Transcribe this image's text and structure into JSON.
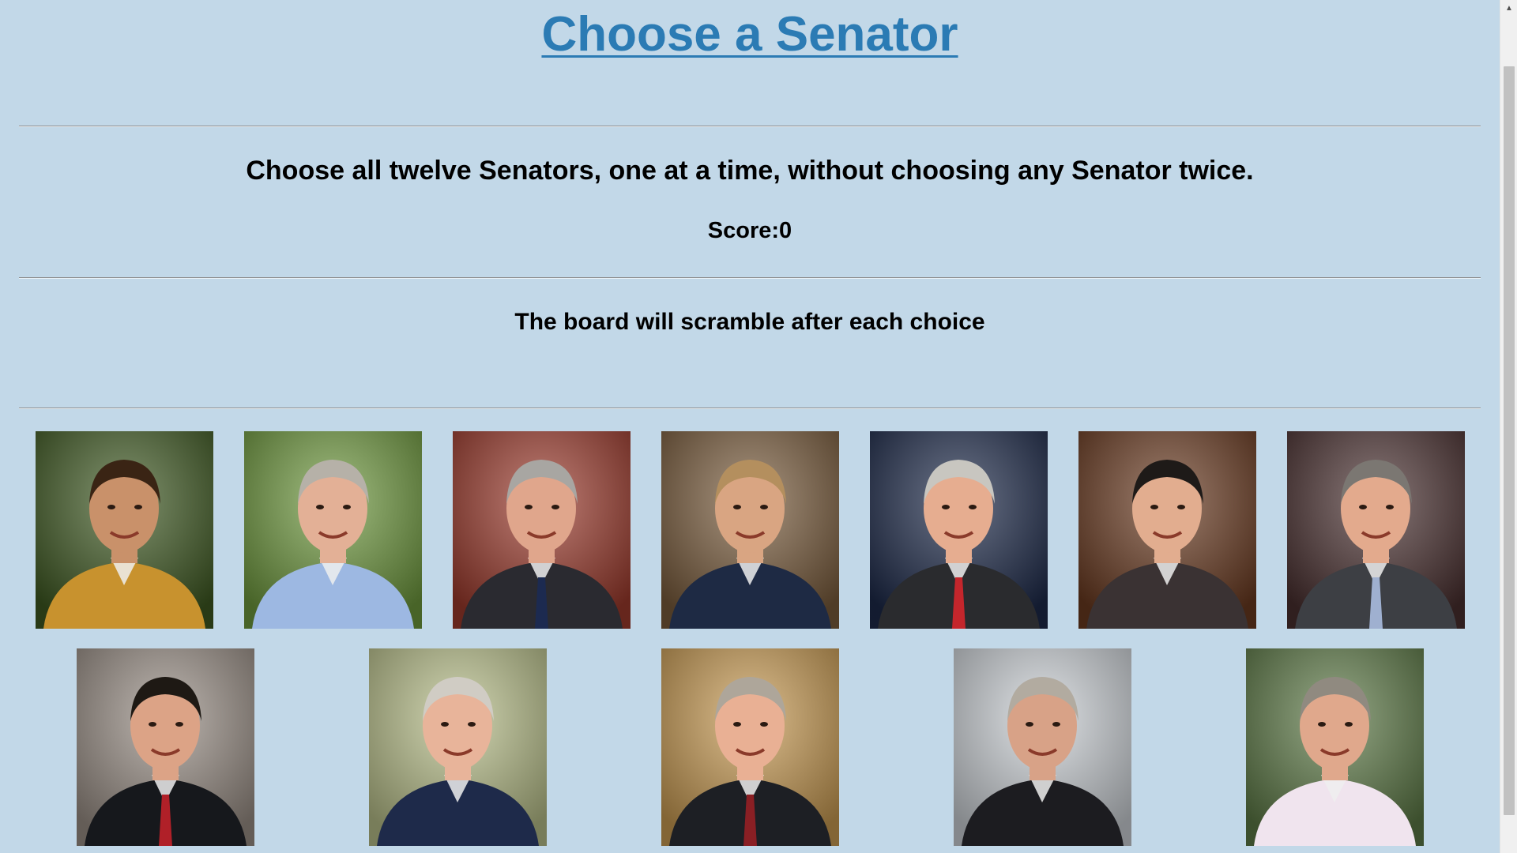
{
  "header": {
    "title": "Choose a Senator"
  },
  "game": {
    "instructions": "Choose all twelve Senators, one at a time, without choosing any Senator twice.",
    "score_text": "Score:0",
    "scramble_note": "The board will scramble after each choice"
  },
  "board": {
    "photos": [
      {
        "id": "senator-photo-1",
        "bg": "#3f5a22",
        "shirt": "#c8922e",
        "hair": "#3a2414",
        "skin": "#c9916a",
        "tie": null
      },
      {
        "id": "senator-photo-2",
        "bg": "#6f9a3e",
        "shirt": "#9db8e2",
        "hair": "#b6b1a8",
        "skin": "#e3b096",
        "tie": null
      },
      {
        "id": "senator-photo-3",
        "bg": "#9d3a2c",
        "shirt": "#2a2a30",
        "hair": "#a8a6a2",
        "skin": "#e0a68c",
        "tie": "#1c2a50"
      },
      {
        "id": "senator-photo-4",
        "bg": "#7a5c3c",
        "shirt": "#1e2a44",
        "hair": "#b48f5e",
        "skin": "#d9a582",
        "tie": null
      },
      {
        "id": "senator-photo-5",
        "bg": "#1d2a4a",
        "shirt": "#2a2b2e",
        "hair": "#c8c6c0",
        "skin": "#e6ad90",
        "tie": "#c4262c"
      },
      {
        "id": "senator-photo-6",
        "bg": "#6a3a20",
        "shirt": "#3a3233",
        "hair": "#1e1a18",
        "skin": "#e2ad8f",
        "tie": null
      },
      {
        "id": "senator-photo-7",
        "bg": "#4a3030",
        "shirt": "#3d3f44",
        "hair": "#7b7772",
        "skin": "#e3aa8d",
        "tie": "#9fb0d0"
      },
      {
        "id": "senator-photo-8",
        "bg": "#9a8f86",
        "shirt": "#16181c",
        "hair": "#1e1914",
        "skin": "#dca386",
        "tie": "#b02028"
      },
      {
        "id": "senator-photo-9",
        "bg": "#b9c08a",
        "shirt": "#1e2a4a",
        "hair": "#d0ccc4",
        "skin": "#e8b49a",
        "tie": null
      },
      {
        "id": "senator-photo-10",
        "bg": "#c99b52",
        "shirt": "#1d1f24",
        "hair": "#aea69a",
        "skin": "#e9b094",
        "tie": "#8a1f24"
      },
      {
        "id": "senator-photo-11",
        "bg": "#cdd2d7",
        "shirt": "#1c1c20",
        "hair": "#b2aba0",
        "skin": "#d8a287",
        "tie": null
      },
      {
        "id": "senator-photo-12",
        "bg": "#5d7a46",
        "shirt": "#f0e4ee",
        "hair": "#908a80",
        "skin": "#e0a88c",
        "tie": null
      }
    ]
  }
}
